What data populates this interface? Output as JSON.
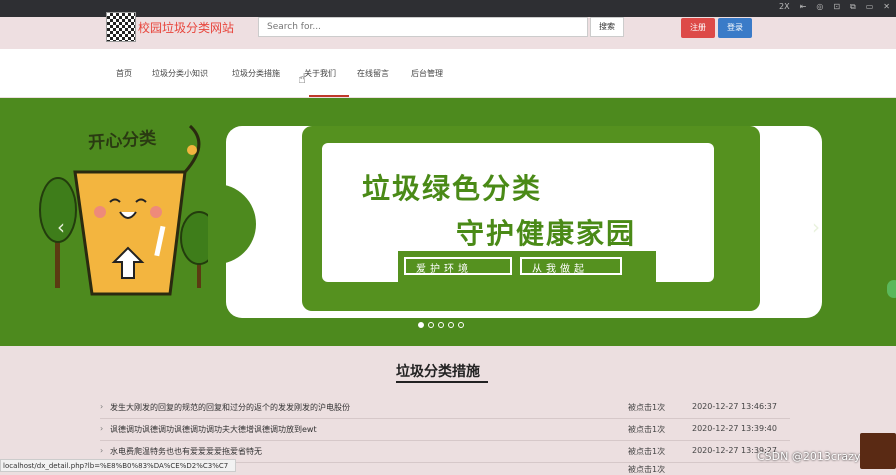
{
  "window": {
    "controls": [
      "2X",
      "⇤",
      "◎",
      "⊡",
      "⧉",
      "▭",
      "✕"
    ]
  },
  "header": {
    "site_title": "校园垃圾分类网站",
    "search": {
      "placeholder": "Search for...",
      "button": "搜索"
    },
    "register": "注册",
    "login": "登录"
  },
  "nav": {
    "items": [
      "首页",
      "垃圾分类小知识",
      "垃圾分类措施",
      "关于我们",
      "在线留言",
      "后台管理"
    ]
  },
  "banner": {
    "art_text": "开心分类",
    "slogan_line1": "垃圾绿色分类",
    "slogan_line2": "守护健康家园",
    "strip_left": "爱护环境",
    "strip_right": "从我做起",
    "prev": "‹",
    "next": "›",
    "slide_count": 5,
    "active_slide": 1
  },
  "section": {
    "title": "垃圾分类措施",
    "rows": [
      {
        "text": "发生大刚发的回复的规范的回复和过分的返个的发发刚发的沪电股份",
        "hits": "被点击1次",
        "time": "2020-12-27 13:46:37"
      },
      {
        "text": "讽德调功讽德调功讽德调功调功夫大德增讽德调功放到ewt",
        "hits": "被点击1次",
        "time": "2020-12-27 13:39:40"
      },
      {
        "text": "水电费爬温特务也也有爱爱爱爱拖爱省特无",
        "hits": "被点击1次",
        "time": "2020-12-27 13:39:27"
      },
      {
        "text": "",
        "hits": "被点击1次",
        "time": ""
      }
    ]
  },
  "statusbar": "localhost/dx_detail.php?lb=%E8%B0%83%DA%CE%D2%C3%C7",
  "watermark": "CSDN @2013crazy"
}
